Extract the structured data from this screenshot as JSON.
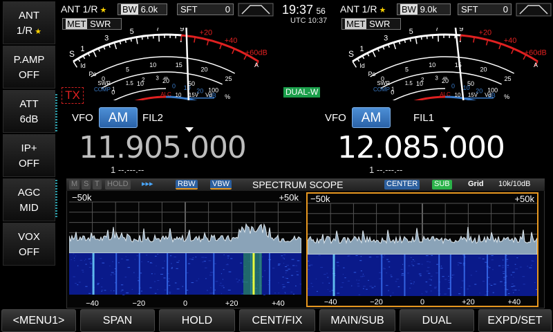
{
  "side_menu": [
    {
      "line1": "ANT",
      "line2": "1/R",
      "star": true
    },
    {
      "line1": "P.AMP",
      "line2": "OFF"
    },
    {
      "line1": "ATT",
      "line2": "6dB"
    },
    {
      "line1": "IP+",
      "line2": "OFF"
    },
    {
      "line1": "AGC",
      "line2": "MID"
    },
    {
      "line1": "VOX",
      "line2": "OFF"
    }
  ],
  "left_rx": {
    "ant": "ANT 1/R",
    "bw_label": "BW",
    "bw_value": "6.0k",
    "sft_label": "SFT",
    "sft_value": "0",
    "met_label": "MET",
    "swr_label": "SWR",
    "tx_badge": "TX",
    "vfo_label": "VFO",
    "mode": "AM",
    "filter": "FIL2",
    "frequency": "11.905.000",
    "memo": "1 --.---.--"
  },
  "right_rx": {
    "ant": "ANT 1/R",
    "bw_label": "BW",
    "bw_value": "9.0k",
    "sft_label": "SFT",
    "sft_value": "0",
    "met_label": "MET",
    "swr_label": "SWR",
    "dual_badge": "DUAL-W",
    "vfo_label": "VFO",
    "mode": "AM",
    "filter": "FIL1",
    "frequency": "12.085.000",
    "memo": "1 --.---.--"
  },
  "clock": {
    "time": "19:37",
    "seconds": "56",
    "utc": "UTC 10:37"
  },
  "meter": {
    "s_label": "S",
    "s_scale": [
      "1",
      "3",
      "5",
      "7",
      "9"
    ],
    "plus_scale": [
      "+20",
      "+40",
      "+60dB"
    ],
    "po_label": "Po",
    "id_label": "Id",
    "id_scale": [
      "0",
      "5",
      "10",
      "15",
      "20",
      "25"
    ],
    "amp_label": "A",
    "po_scale": [
      "0",
      "10",
      "20",
      "50",
      "100",
      "%"
    ],
    "swr_label": "SWR",
    "swr_scale": [
      "1",
      "1.5",
      "2",
      "3",
      "∞"
    ],
    "comp_label": "COMP",
    "comp_scale": [
      "0",
      "10",
      "20",
      "dB"
    ],
    "alc_label": "ALC",
    "vd_scale": [
      "10",
      "15V"
    ],
    "vd_label": "Vd"
  },
  "scope": {
    "title": "SPECTRUM SCOPE",
    "m": "M",
    "s": "S",
    "t": "T",
    "hold": "HOLD",
    "arrows": "▸▸▸",
    "rbw": "RBW",
    "vbw": "VBW",
    "center": "CENTER",
    "sub": "SUB",
    "grid": "Grid",
    "ref": "10k/10dB",
    "span_left": "−50k",
    "span_right": "+50k",
    "ticks": [
      "−40",
      "−20",
      "0",
      "+20",
      "+40"
    ]
  },
  "bottom_menu": [
    "<MENU1>",
    "SPAN",
    "HOLD",
    "CENT/FIX",
    "MAIN/SUB",
    "DUAL",
    "EXPD/SET"
  ],
  "colors": {
    "accent_blue": "#3a7bc8",
    "tx_red": "#e02020",
    "dual_green": "#1a9e4a",
    "select_orange": "#e89820",
    "sub_green": "#2bb34a"
  }
}
